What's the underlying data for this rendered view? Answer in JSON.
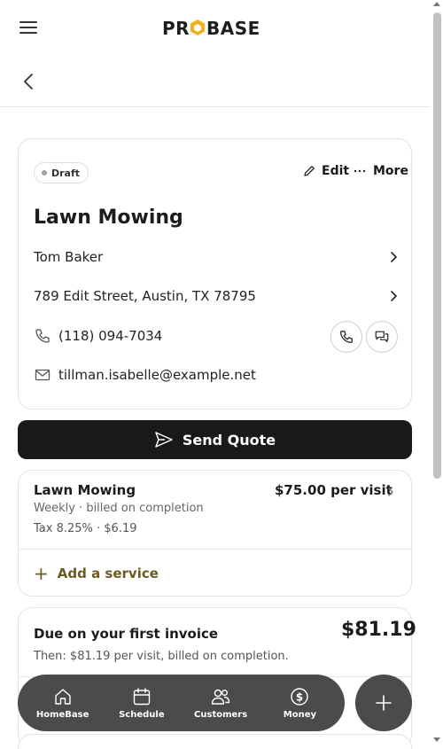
{
  "header": {
    "logo_text": "PROBASE",
    "brand_color": "#1d1d1d",
    "accent_color": "#f2b01e"
  },
  "quote": {
    "status": "Draft",
    "edit_label": "Edit",
    "more_label": "More",
    "title": "Lawn Mowing",
    "customer": "Tom Baker",
    "address": "789 Edit Street, Austin, TX 78795",
    "phone": "(118) 094-7034",
    "email": "tillman.isabelle@example.net"
  },
  "send_label": "Send Quote",
  "service": {
    "name": "Lawn Mowing",
    "price": "$75.00 per visit",
    "frequency": "Weekly · billed on completion",
    "tax": "Tax 8.25% · $6.19",
    "add_label": "Add a service"
  },
  "invoice": {
    "label": "Due on your first invoice",
    "amount": "$81.19",
    "subtext": "Then: $81.19 per visit, billed on completion."
  },
  "nav": {
    "items": [
      {
        "label": "HomeBase",
        "icon": "home-icon"
      },
      {
        "label": "Schedule",
        "icon": "calendar-icon"
      },
      {
        "label": "Customers",
        "icon": "users-icon"
      },
      {
        "label": "Money",
        "icon": "dollar-icon"
      }
    ],
    "fab_icon": "plus-icon"
  }
}
